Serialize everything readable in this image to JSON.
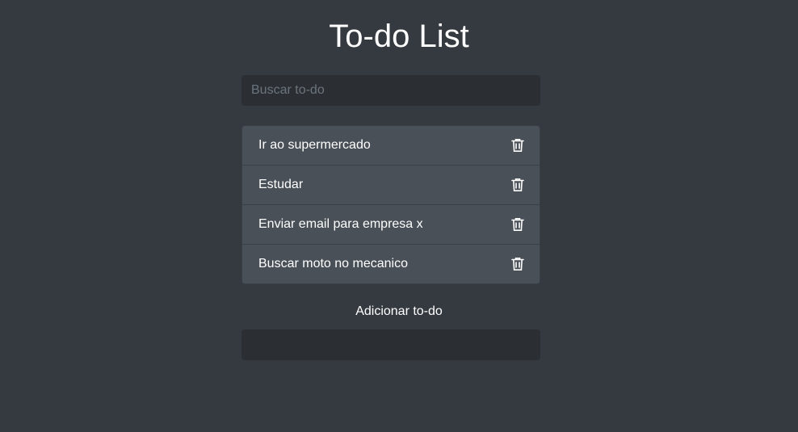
{
  "page": {
    "title": "To-do List"
  },
  "search": {
    "placeholder": "Buscar to-do",
    "value": ""
  },
  "todos": [
    {
      "text": "Ir ao supermercado",
      "icon": "trash-icon"
    },
    {
      "text": "Estudar",
      "icon": "trash-icon"
    },
    {
      "text": "Enviar email para empresa x",
      "icon": "trash-icon"
    },
    {
      "text": "Buscar moto no mecanico",
      "icon": "trash-icon"
    }
  ],
  "add": {
    "label": "Adicionar to-do",
    "value": ""
  },
  "colors": {
    "background": "#343a40",
    "input_bg": "#2b2f33",
    "item_bg": "#495057",
    "text": "#ffffff",
    "placeholder": "#6c757d"
  }
}
